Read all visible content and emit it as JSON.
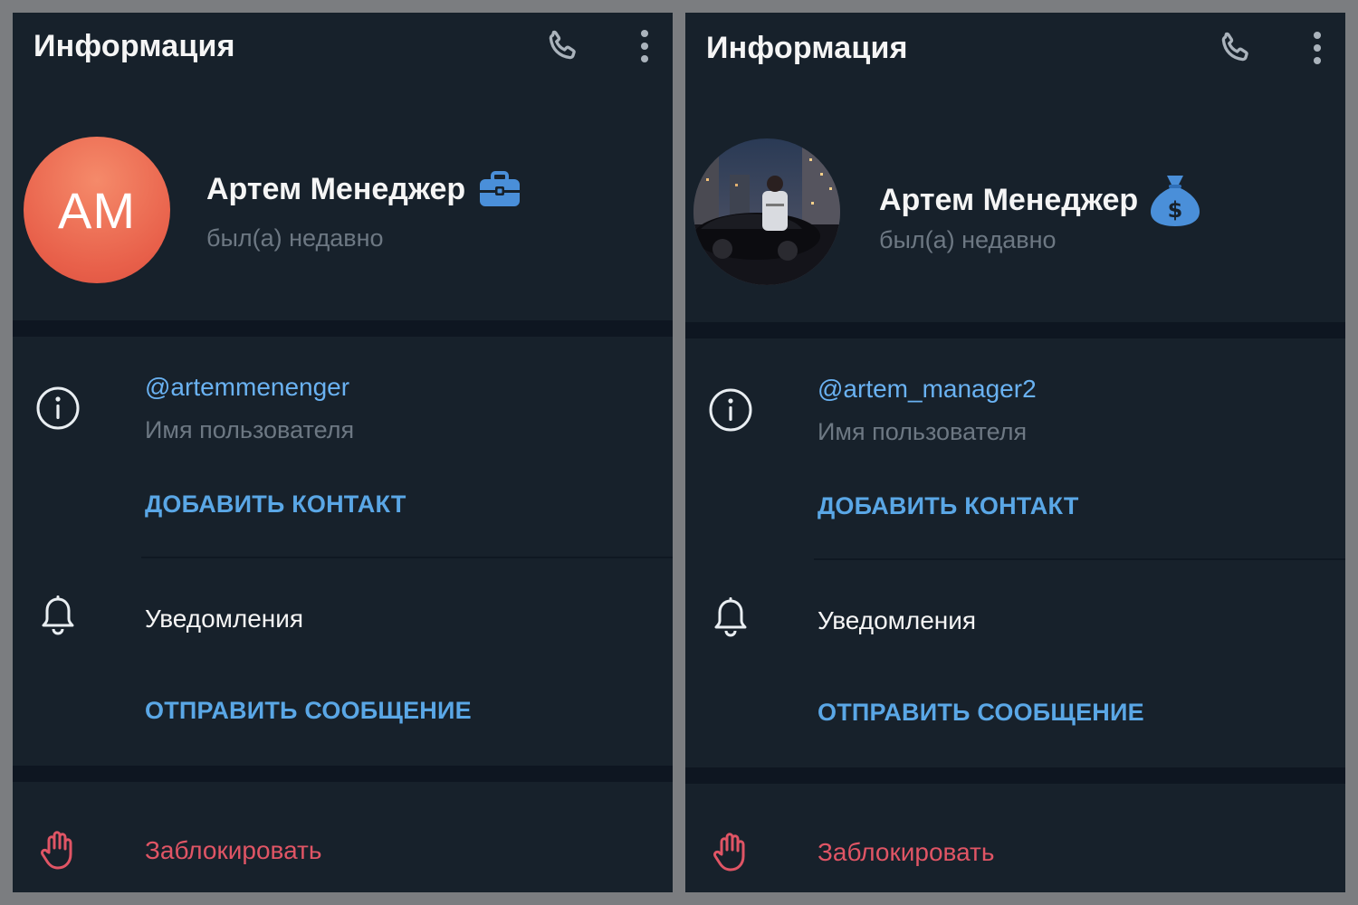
{
  "panels": [
    {
      "header_title": "Информация",
      "icons": {
        "call": "phone-icon",
        "more": "more-vertical-icon"
      },
      "avatar": {
        "type": "initials",
        "initials": "АМ",
        "color": "#e8604a"
      },
      "name": "Артем Менеджер",
      "emoji_status": "briefcase-icon",
      "status": "был(а) недавно",
      "username": "@artemmenenger",
      "username_caption": "Имя пользователя",
      "add_contact": "ДОБАВИТЬ КОНТАКТ",
      "notifications": "Уведомления",
      "send_message": "ОТПРАВИТЬ СООБЩЕНИЕ",
      "block": "Заблокировать"
    },
    {
      "header_title": "Информация",
      "icons": {
        "call": "phone-icon",
        "more": "more-vertical-icon"
      },
      "avatar": {
        "type": "photo",
        "description": "night-city-car-photo"
      },
      "name": "Артем Менеджер",
      "emoji_status": "money-bag-icon",
      "status": "был(а) недавно",
      "username": "@artem_manager2",
      "username_caption": "Имя пользователя",
      "add_contact": "ДОБАВИТЬ КОНТАКТ",
      "notifications": "Уведомления",
      "send_message": "ОТПРАВИТЬ СООБЩЕНИЕ",
      "block": "Заблокировать"
    }
  ],
  "colors": {
    "panel_bg": "#17212b",
    "separator": "#0e1621",
    "link": "#5aa7e6",
    "username": "#6ab2f2",
    "muted": "#6d7883",
    "danger": "#e05565",
    "icon": "#aab3bc",
    "emoji_status": "#4a8fd9"
  }
}
